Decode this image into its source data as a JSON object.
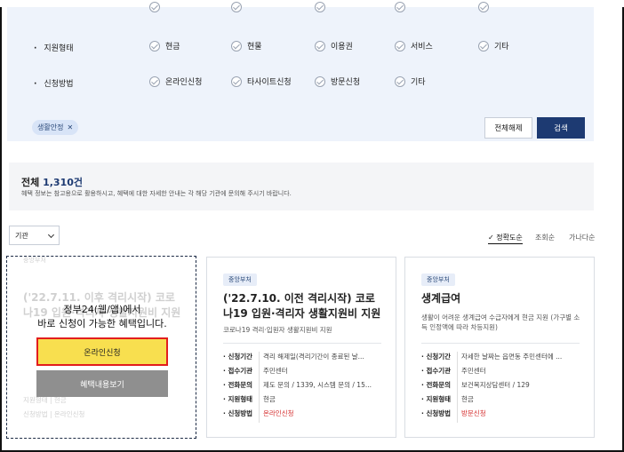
{
  "filter": {
    "support_type": {
      "label": "지원형태",
      "options": [
        "현금",
        "현물",
        "이용권",
        "서비스",
        "기타"
      ]
    },
    "apply_method": {
      "label": "신청방법",
      "options": [
        "온라인신청",
        "타사이트신청",
        "방문신청",
        "기타"
      ]
    },
    "selected_tag": "생활안정",
    "reset_label": "전체해제",
    "search_label": "검색"
  },
  "total": {
    "prefix": "전체",
    "count": "1,310건",
    "note": "혜택 정보는 참고용으로 활용하시고, 혜택에 대한 자세한 안내는 각 해당 기관에 문의해 주시기 바랍니다."
  },
  "sort": {
    "agency_select": "기관",
    "options": [
      "정확도순",
      "조회순",
      "가나다순"
    ],
    "active": "정확도순"
  },
  "overlay": {
    "line1": "정부24(웹/앱)에서",
    "line2": "바로 신청이 가능한 혜택입니다.",
    "online_label": "온라인신청",
    "detail_label": "혜택내용보기",
    "ghost_badge": "중앙부처",
    "ghost_title": "('22.7.11. 이후 격리시작) 코로나19 입원·격리자 생활지원비 지원",
    "ghost_row_k": "지원형태",
    "ghost_row_v": "현금",
    "ghost_row2_k": "신청방법",
    "ghost_row2_v": "온라인신청"
  },
  "cards": [
    {
      "badge": "중앙부처",
      "title": "('22.7.10. 이전 격리시작) 코로나19 입원·격리자 생활지원비 지원",
      "desc": "코로나19 격리·입원자 생활지원비 지원",
      "rows": [
        {
          "k": "신청기간",
          "v": "격리 해제일(격리기간이 종료된 날..."
        },
        {
          "k": "접수기관",
          "v": "주민센터"
        },
        {
          "k": "전화문의",
          "v": "제도 문의 / 1339, 시스템 문의 / 15..."
        },
        {
          "k": "지원형태",
          "v": "현금"
        },
        {
          "k": "신청방법",
          "v": "온라인신청"
        }
      ]
    },
    {
      "badge": "중앙부처",
      "title": "생계급여",
      "desc": "생활이 어려운 생계급여 수급자에게 현금 지원 (가구별 소득 인정액에 따라 차등지원)",
      "rows": [
        {
          "k": "신청기간",
          "v": "자세한 날짜는 읍면동 주민센터에 ..."
        },
        {
          "k": "접수기관",
          "v": "주민센터"
        },
        {
          "k": "전화문의",
          "v": "보건복지상담센터 / 129"
        },
        {
          "k": "지원형태",
          "v": "현금"
        },
        {
          "k": "신청방법",
          "v": "방문신청"
        }
      ]
    }
  ]
}
